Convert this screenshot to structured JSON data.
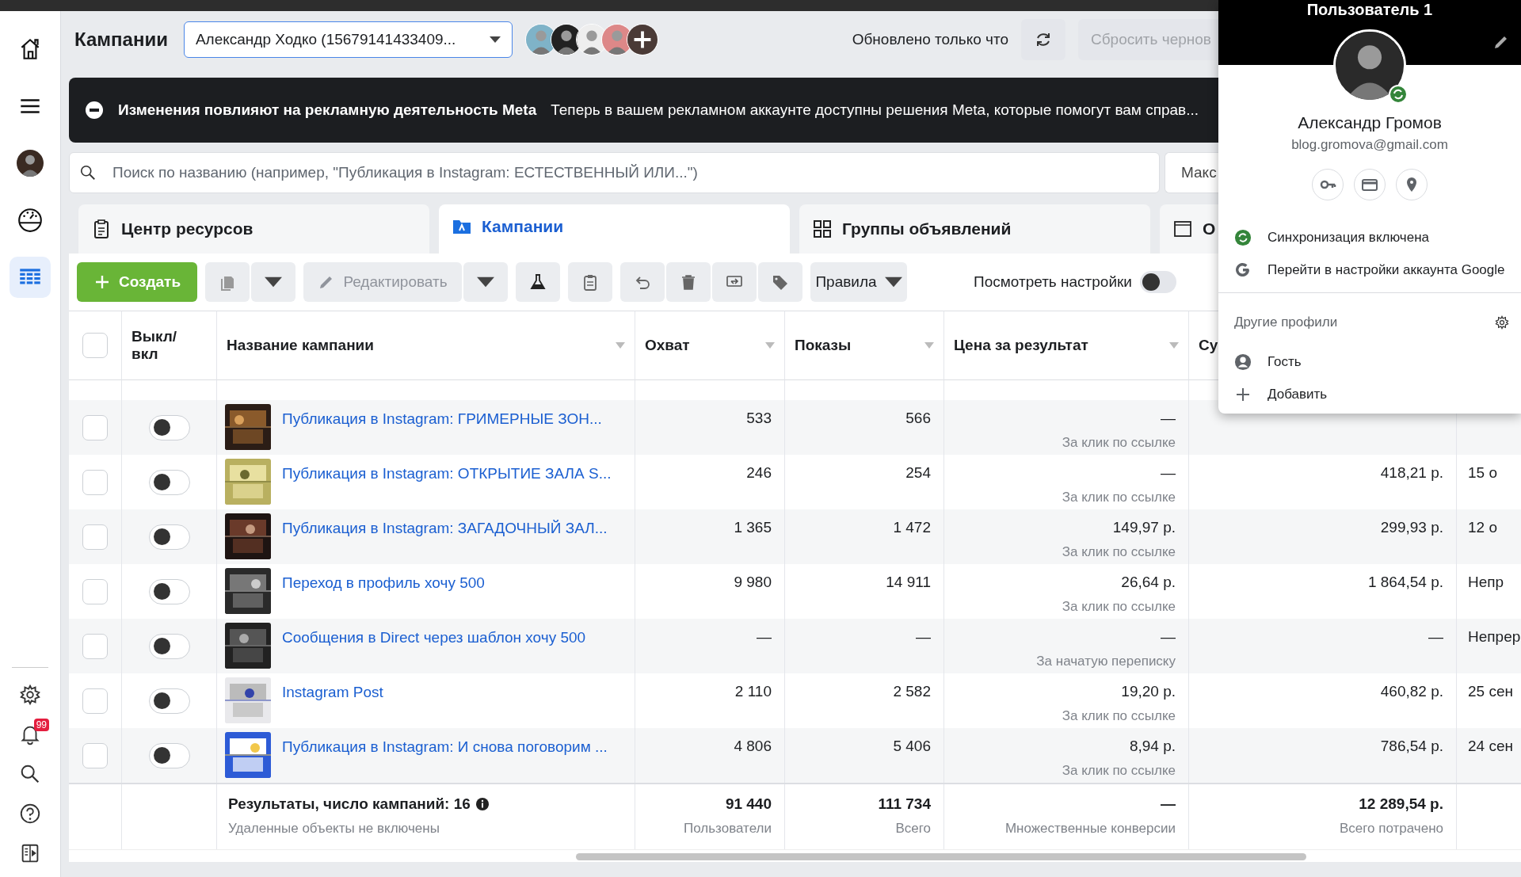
{
  "sidebar": {
    "items": [
      {
        "kind": "home",
        "selected": false
      },
      {
        "kind": "menu",
        "selected": false
      },
      {
        "kind": "avatar",
        "selected": false
      },
      {
        "kind": "gauge",
        "selected": false
      },
      {
        "kind": "table",
        "selected": true
      }
    ],
    "bottom_items": [
      {
        "kind": "settings"
      },
      {
        "kind": "bell",
        "badge": "99"
      },
      {
        "kind": "search"
      },
      {
        "kind": "help"
      },
      {
        "kind": "panel"
      }
    ]
  },
  "header": {
    "title": "Кампании",
    "account": "Александр Ходко (15679141433409...",
    "updated": "Обновлено только что",
    "discard_button": "Сбросить чернов"
  },
  "banner": {
    "title": "Изменения повлияют на рекламную деятельность Meta",
    "text": "Теперь в вашем рекламном аккаунте доступны решения Meta, которые помогут вам справ..."
  },
  "search": {
    "placeholder": "Поиск по названию (например, \"Публикация в Instagram: ЕСТЕСТВЕННЫЙ ИЛИ...\")",
    "button": "Макс"
  },
  "tabs": [
    {
      "label": "Центр ресурсов",
      "kind": "resources",
      "selected": false
    },
    {
      "label": "Кампании",
      "kind": "campaigns",
      "selected": true
    },
    {
      "label": "Группы объявлений",
      "kind": "adsets",
      "selected": false
    },
    {
      "label": "О",
      "kind": "ads",
      "selected": false
    }
  ],
  "toolbar": {
    "create": "Создать",
    "edit": "Редактировать",
    "rules": "Правила",
    "view_settings": "Посмотреть настройки",
    "view_settings_on": false
  },
  "table": {
    "all_checked": false,
    "columns": [
      "Выкл/ вкл",
      "Название кампании",
      "Охват",
      "Показы",
      "Цена за результат",
      "Су"
    ],
    "rows": [
      {
        "checked": false,
        "on": false,
        "name": "Публикация в Instagram: ГРИМЕРНЫЕ ЗОН...",
        "reach": "533",
        "impressions": "566",
        "cost": "—",
        "cost_type": "За клик по ссылке"
      },
      {
        "checked": false,
        "on": false,
        "name": "Публикация в Instagram: ОТКРЫТИЕ ЗАЛА S...",
        "reach": "246",
        "impressions": "254",
        "cost": "—",
        "cost_type": "За клик по ссылке",
        "amount": "418,21 р.",
        "date": "15 о"
      },
      {
        "checked": false,
        "on": false,
        "name": "Публикация в Instagram: ЗАГАДОЧНЫЙ ЗАЛ...",
        "reach": "1 365",
        "impressions": "1 472",
        "cost": "149,97 р.",
        "cost_type": "За клик по ссылке",
        "amount": "299,93 р.",
        "date": "12 о"
      },
      {
        "checked": false,
        "on": false,
        "name": "Переход в профиль хочу 500",
        "reach": "9 980",
        "impressions": "14 911",
        "cost": "26,64 р.",
        "cost_type": "За клик по ссылке",
        "amount": "1 864,54 р.",
        "date": "Непр"
      },
      {
        "checked": false,
        "on": false,
        "name": "Сообщения в Direct через шаблон хочу 500",
        "reach": "—",
        "impressions": "—",
        "cost": "—",
        "cost_type": "За начатую переписку",
        "amount": "—",
        "date": "Непрер"
      },
      {
        "checked": false,
        "on": false,
        "name": "Instagram Post",
        "reach": "2 110",
        "impressions": "2 582",
        "cost": "19,20 р.",
        "cost_type": "За клик по ссылке",
        "amount": "460,82 р.",
        "date": "25 сен"
      },
      {
        "checked": false,
        "on": false,
        "name": "Публикация в Instagram: И снова поговорим ...",
        "reach": "4 806",
        "impressions": "5 406",
        "cost": "8,94 р.",
        "cost_type": "За клик по ссылке",
        "amount": "786,54 р.",
        "date": "24 сен"
      }
    ],
    "footer": {
      "title": "Результаты, число кампаний: 16",
      "note": "Удаленные объекты не включены",
      "reach": "91 440",
      "reach_label": "Пользователи",
      "impressions": "111 734",
      "impressions_label": "Всего",
      "cost": "—",
      "cost_label": "Множественные конверсии",
      "amount": "12 289,54 р.",
      "amount_label": "Всего потрачено"
    }
  },
  "profile_panel": {
    "title": "Пользователь 1",
    "name": "Александр Громов",
    "email": "blog.gromova@gmail.com",
    "sync": "Синхронизация включена",
    "google": "Перейти в настройки аккаунта Google",
    "other_profiles": "Другие профили",
    "guest": "Гость",
    "add": "Добавить"
  }
}
